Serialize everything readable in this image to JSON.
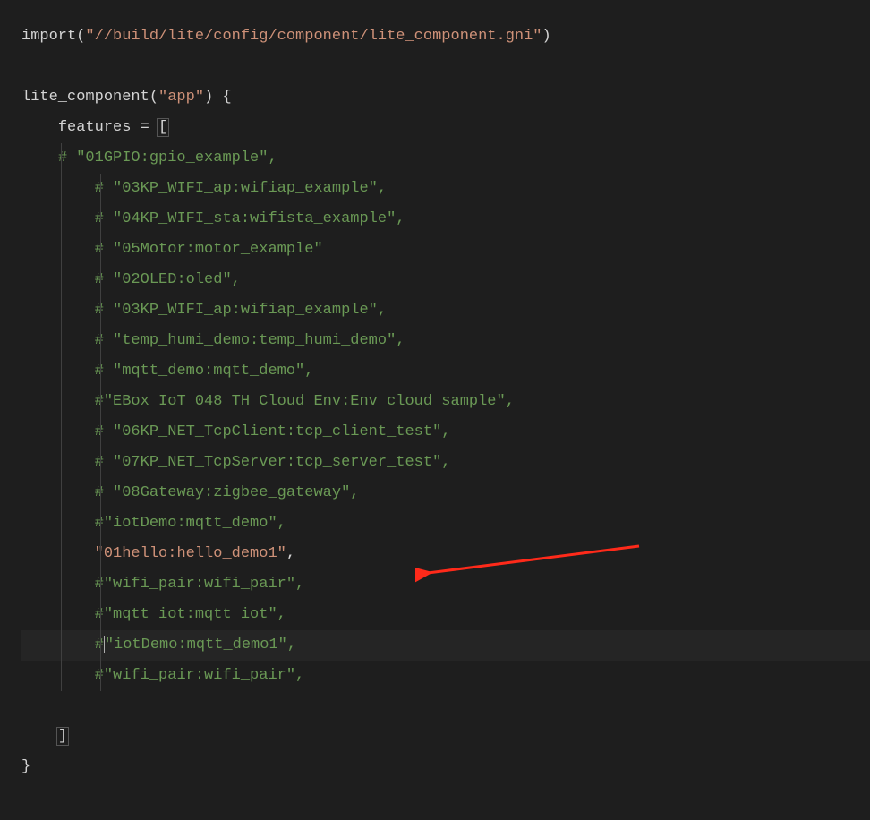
{
  "code": {
    "import_line": "import",
    "import_open": "(",
    "import_path": "\"//build/lite/config/component/lite_component.gni\"",
    "import_close": ")",
    "blank": "",
    "func_name": "lite_component",
    "func_paren_open": "(",
    "func_arg": "\"app\"",
    "func_paren_close_brace": ") {",
    "features_key": "features",
    "equals": " = ",
    "open_bracket": "[",
    "lines": [
      {
        "indent": "    ",
        "comment": "# \"01GPIO:gpio_example\","
      },
      {
        "indent": "        ",
        "comment": "# \"03KP_WIFI_ap:wifiap_example\","
      },
      {
        "indent": "        ",
        "comment": "# \"04KP_WIFI_sta:wifista_example\","
      },
      {
        "indent": "        ",
        "comment": "# \"05Motor:motor_example\""
      },
      {
        "indent": "        ",
        "comment": "# \"02OLED:oled\","
      },
      {
        "indent": "        ",
        "comment": "# \"03KP_WIFI_ap:wifiap_example\","
      },
      {
        "indent": "        ",
        "comment": "# \"temp_humi_demo:temp_humi_demo\","
      },
      {
        "indent": "        ",
        "comment": "# \"mqtt_demo:mqtt_demo\","
      },
      {
        "indent": "        ",
        "comment": "#\"EBox_IoT_048_TH_Cloud_Env:Env_cloud_sample\","
      },
      {
        "indent": "        ",
        "comment": "# \"06KP_NET_TcpClient:tcp_client_test\","
      },
      {
        "indent": "        ",
        "comment": "# \"07KP_NET_TcpServer:tcp_server_test\","
      },
      {
        "indent": "        ",
        "comment": "# \"08Gateway:zigbee_gateway\","
      },
      {
        "indent": "        ",
        "comment": "#\"iotDemo:mqtt_demo\","
      },
      {
        "indent": "        ",
        "active": true,
        "str": "\"01hello:hello_demo1\"",
        "after": ","
      },
      {
        "indent": "        ",
        "comment": "#\"wifi_pair:wifi_pair\","
      },
      {
        "indent": "        ",
        "comment": "#\"mqtt_iot:mqtt_iot\","
      },
      {
        "indent": "        ",
        "cursor_split": true,
        "c1": "#",
        "c2": "\"iotDemo:mqtt_demo1\","
      },
      {
        "indent": "        ",
        "comment": "#\"wifi_pair:wifi_pair\","
      }
    ],
    "close_bracket": "]",
    "close_brace": "}"
  }
}
